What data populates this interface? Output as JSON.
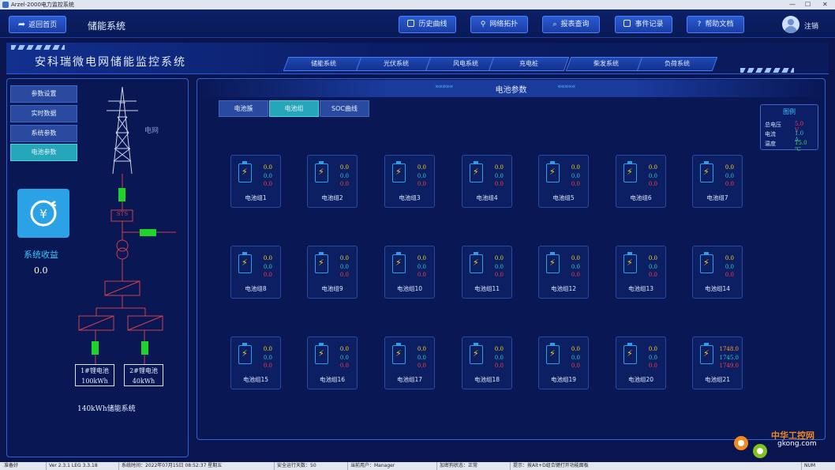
{
  "window": {
    "title": "Arzel-2000电力监控系统"
  },
  "topbar": {
    "back_label": "返回首页",
    "page_title": "储能系统",
    "buttons": [
      {
        "label": "历史曲线",
        "icon": "chart-icon"
      },
      {
        "label": "网络拓扑",
        "icon": "network-icon"
      },
      {
        "label": "报表查询",
        "icon": "search-icon"
      },
      {
        "label": "事件记录",
        "icon": "document-icon"
      },
      {
        "label": "帮助文档",
        "icon": "help-icon"
      }
    ],
    "logout_label": "注销"
  },
  "banner": {
    "title": "安科瑞微电网储能监控系统"
  },
  "nav_tabs": [
    "储能系统",
    "光伏系统",
    "风电系统",
    "充电桩",
    "柴发系统",
    "负荷系统"
  ],
  "sidebar": {
    "items": [
      {
        "label": "参数设置",
        "active": false
      },
      {
        "label": "实时数据",
        "active": false
      },
      {
        "label": "系统参数",
        "active": false
      },
      {
        "label": "电池参数",
        "active": true
      }
    ],
    "revenue_label": "系统收益",
    "revenue_value": "0.0"
  },
  "diagram": {
    "grid_label": "电网",
    "sts_label": "STS",
    "battery1_line1": "1#锂电池",
    "battery1_line2": "100kWh",
    "battery2_line1": "2#锂电池",
    "battery2_line2": "40kWh",
    "system_label": "140kWh储能系统"
  },
  "content": {
    "title": "电池参数",
    "left_chevrons": "»»»»»",
    "right_chevrons": "«««««",
    "tabs": [
      {
        "label": "电池簇",
        "active": false
      },
      {
        "label": "电池组",
        "active": true
      },
      {
        "label": "SOC曲线",
        "active": false
      }
    ]
  },
  "legend": {
    "title": "图例",
    "rows": [
      {
        "label": "总电压",
        "value": "5.0 V",
        "color": "#ff3b3b"
      },
      {
        "label": "电流",
        "value": "1.0 A",
        "color": "#34c7c7"
      },
      {
        "label": "温度",
        "value": "15.0 ℃",
        "color": "#33dd55"
      }
    ]
  },
  "battery_groups": [
    {
      "name": "电池组1",
      "v1": "0.0",
      "v2": "0.0",
      "v3": "0.0"
    },
    {
      "name": "电池组2",
      "v1": "0.0",
      "v2": "0.0",
      "v3": "0.0"
    },
    {
      "name": "电池组3",
      "v1": "0.0",
      "v2": "0.0",
      "v3": "0.0"
    },
    {
      "name": "电池组4",
      "v1": "0.0",
      "v2": "0.0",
      "v3": "0.0"
    },
    {
      "name": "电池组5",
      "v1": "0.0",
      "v2": "0.0",
      "v3": "0.0"
    },
    {
      "name": "电池组6",
      "v1": "0.0",
      "v2": "0.0",
      "v3": "0.0"
    },
    {
      "name": "电池组7",
      "v1": "0.0",
      "v2": "0.0",
      "v3": "0.0"
    },
    {
      "name": "电池组8",
      "v1": "0.0",
      "v2": "0.0",
      "v3": "0.0"
    },
    {
      "name": "电池组9",
      "v1": "0.0",
      "v2": "0.0",
      "v3": "0.0"
    },
    {
      "name": "电池组10",
      "v1": "0.0",
      "v2": "0.0",
      "v3": "0.0"
    },
    {
      "name": "电池组11",
      "v1": "0.0",
      "v2": "0.0",
      "v3": "0.0"
    },
    {
      "name": "电池组12",
      "v1": "0.0",
      "v2": "0.0",
      "v3": "0.0"
    },
    {
      "name": "电池组13",
      "v1": "0.0",
      "v2": "0.0",
      "v3": "0.0"
    },
    {
      "name": "电池组14",
      "v1": "0.0",
      "v2": "0.0",
      "v3": "0.0"
    },
    {
      "name": "电池组15",
      "v1": "0.0",
      "v2": "0.0",
      "v3": "0.0"
    },
    {
      "name": "电池组16",
      "v1": "0.0",
      "v2": "0.0",
      "v3": "0.0"
    },
    {
      "name": "电池组17",
      "v1": "0.0",
      "v2": "0.0",
      "v3": "0.0"
    },
    {
      "name": "电池组18",
      "v1": "0.0",
      "v2": "0.0",
      "v3": "0.0"
    },
    {
      "name": "电池组19",
      "v1": "0.0",
      "v2": "0.0",
      "v3": "0.0"
    },
    {
      "name": "电池组20",
      "v1": "0.0",
      "v2": "0.0",
      "v3": "0.0"
    },
    {
      "name": "电池组21",
      "v1": "1748.0",
      "v2": "1745.0",
      "v3": "1749.0"
    }
  ],
  "statusbar": {
    "ready": "准备好",
    "version": "Ver 2.3.1 LEG 3.3.18",
    "time": "系统时间：2022年07月15日  08:52:37  星期五",
    "days": "安全运行天数：50",
    "user": "当前用户：Manager",
    "lock": "加密狗状态：正常",
    "hint": "提示：按Alt+D组合键打开功能面板",
    "num": "NUM"
  },
  "watermark": {
    "line1": "中华工控网",
    "line2": "gkong.com"
  }
}
